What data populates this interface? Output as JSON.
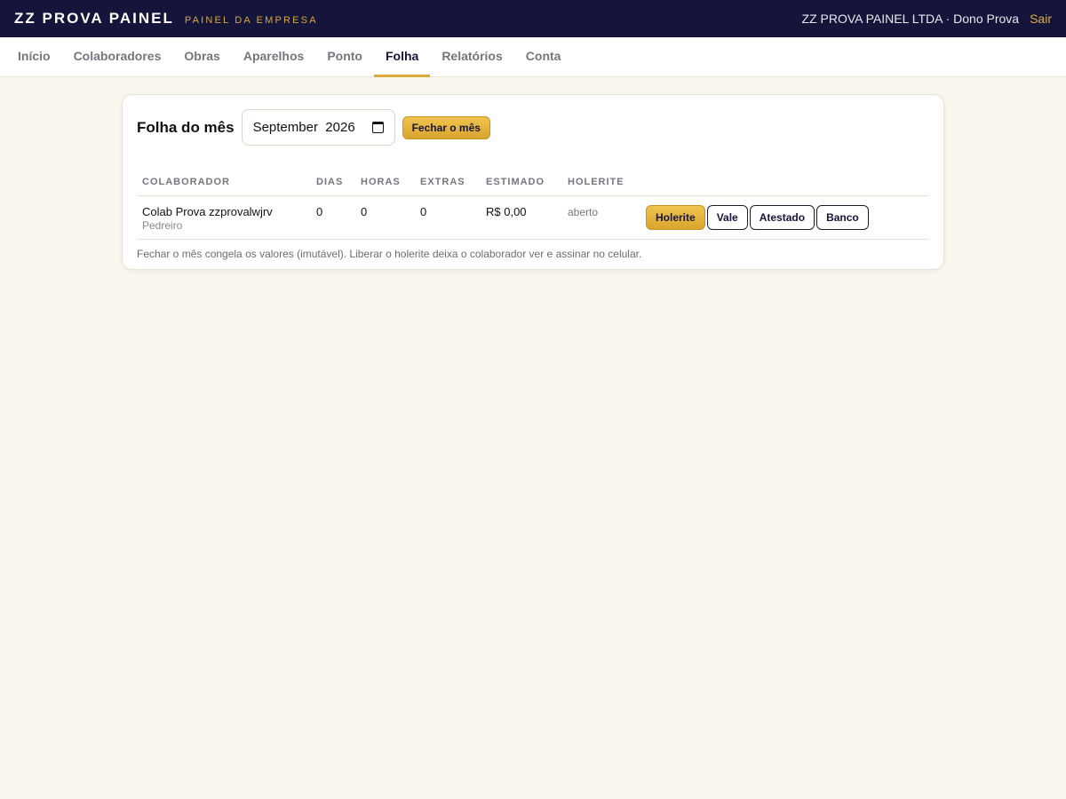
{
  "header": {
    "brand": "ZZ PROVA PAINEL",
    "subtitle": "PAINEL DA EMPRESA",
    "company": "ZZ PROVA PAINEL LTDA · Dono Prova",
    "logout": "Sair"
  },
  "nav": {
    "tabs": [
      {
        "label": "Início"
      },
      {
        "label": "Colaboradores"
      },
      {
        "label": "Obras"
      },
      {
        "label": "Aparelhos"
      },
      {
        "label": "Ponto"
      },
      {
        "label": "Folha",
        "active": true
      },
      {
        "label": "Relatórios"
      },
      {
        "label": "Conta"
      }
    ]
  },
  "payroll": {
    "title": "Folha do mês",
    "month_value": "September  2026",
    "close_month": "Fechar o mês",
    "columns": [
      "COLABORADOR",
      "DIAS",
      "HORAS",
      "EXTRAS",
      "ESTIMADO",
      "HOLERITE"
    ],
    "rows": [
      {
        "name": "Colab Prova zzprovalwjrv",
        "role": "Pedreiro",
        "dias": "0",
        "horas": "0",
        "extras": "0",
        "estimado": "R$ 0,00",
        "holerite": "aberto",
        "actions": {
          "holerite": "Holerite",
          "vale": "Vale",
          "atestado": "Atestado",
          "banco": "Banco"
        }
      }
    ],
    "note": "Fechar o mês congela os valores (imutável). Liberar o holerite deixa o colaborador ver e assinar no celular."
  },
  "colors": {
    "topbar": "#15143a",
    "accent": "#d9a93a",
    "background": "#f9f6ee"
  }
}
